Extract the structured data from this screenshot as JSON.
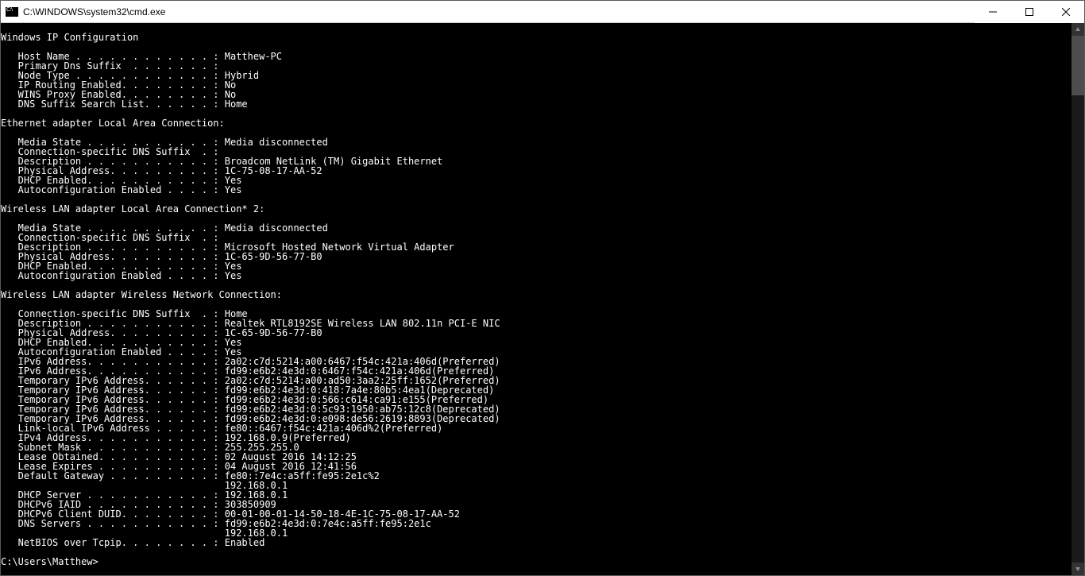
{
  "titlebar": {
    "title": "C:\\WINDOWS\\system32\\cmd.exe"
  },
  "output": {
    "blank0": "",
    "header": "Windows IP Configuration",
    "blank1": "",
    "hostname_line": "   Host Name . . . . . . . . . . . . : Matthew-PC",
    "primdns_line": "   Primary Dns Suffix  . . . . . . . :",
    "nodetype_line": "   Node Type . . . . . . . . . . . . : Hybrid",
    "iprouting_line": "   IP Routing Enabled. . . . . . . . : No",
    "winsproxy_line": "   WINS Proxy Enabled. . . . . . . . : No",
    "dnssuffix_line": "   DNS Suffix Search List. . . . . . : Home",
    "blank2": "",
    "eth_header": "Ethernet adapter Local Area Connection:",
    "blank3": "",
    "eth_media": "   Media State . . . . . . . . . . . : Media disconnected",
    "eth_connspec": "   Connection-specific DNS Suffix  . :",
    "eth_desc": "   Description . . . . . . . . . . . : Broadcom NetLink (TM) Gigabit Ethernet",
    "eth_phys": "   Physical Address. . . . . . . . . : 1C-75-08-17-AA-52",
    "eth_dhcp": "   DHCP Enabled. . . . . . . . . . . : Yes",
    "eth_autoconf": "   Autoconfiguration Enabled . . . . : Yes",
    "blank4": "",
    "wlan2_header": "Wireless LAN adapter Local Area Connection* 2:",
    "blank5": "",
    "wlan2_media": "   Media State . . . . . . . . . . . : Media disconnected",
    "wlan2_connspec": "   Connection-specific DNS Suffix  . :",
    "wlan2_desc": "   Description . . . . . . . . . . . : Microsoft Hosted Network Virtual Adapter",
    "wlan2_phys": "   Physical Address. . . . . . . . . : 1C-65-9D-56-77-B0",
    "wlan2_dhcp": "   DHCP Enabled. . . . . . . . . . . : Yes",
    "wlan2_autoconf": "   Autoconfiguration Enabled . . . . : Yes",
    "blank6": "",
    "wlan_header": "Wireless LAN adapter Wireless Network Connection:",
    "blank7": "",
    "wlan_connspec": "   Connection-specific DNS Suffix  . : Home",
    "wlan_desc": "   Description . . . . . . . . . . . : Realtek RTL8192SE Wireless LAN 802.11n PCI-E NIC",
    "wlan_phys": "   Physical Address. . . . . . . . . : 1C-65-9D-56-77-B0",
    "wlan_dhcp": "   DHCP Enabled. . . . . . . . . . . : Yes",
    "wlan_autoconf": "   Autoconfiguration Enabled . . . . : Yes",
    "wlan_ipv6a": "   IPv6 Address. . . . . . . . . . . : 2a02:c7d:5214:a00:6467:f54c:421a:406d(Preferred)",
    "wlan_ipv6b": "   IPv6 Address. . . . . . . . . . . : fd99:e6b2:4e3d:0:6467:f54c:421a:406d(Preferred)",
    "wlan_tmp1": "   Temporary IPv6 Address. . . . . . : 2a02:c7d:5214:a00:ad50:3aa2:25ff:1652(Preferred)",
    "wlan_tmp2": "   Temporary IPv6 Address. . . . . . : fd99:e6b2:4e3d:0:418:7a4e:80b5:4ea1(Deprecated)",
    "wlan_tmp3": "   Temporary IPv6 Address. . . . . . : fd99:e6b2:4e3d:0:566:c614:ca91:e155(Preferred)",
    "wlan_tmp4": "   Temporary IPv6 Address. . . . . . : fd99:e6b2:4e3d:0:5c93:1950:ab75:12c8(Deprecated)",
    "wlan_tmp5": "   Temporary IPv6 Address. . . . . . : fd99:e6b2:4e3d:0:e098:de56:2619:8893(Deprecated)",
    "wlan_linklocal": "   Link-local IPv6 Address . . . . . : fe80::6467:f54c:421a:406d%2(Preferred)",
    "wlan_ipv4": "   IPv4 Address. . . . . . . . . . . : 192.168.0.9(Preferred)",
    "wlan_subnet": "   Subnet Mask . . . . . . . . . . . : 255.255.255.0",
    "wlan_lease_obt": "   Lease Obtained. . . . . . . . . . : 02 August 2016 14:12:25",
    "wlan_lease_exp": "   Lease Expires . . . . . . . . . . : 04 August 2016 12:41:56",
    "wlan_gw1": "   Default Gateway . . . . . . . . . : fe80::7e4c:a5ff:fe95:2e1c%2",
    "wlan_gw2": "                                       192.168.0.1",
    "wlan_dhcpserv": "   DHCP Server . . . . . . . . . . . : 192.168.0.1",
    "wlan_iaid": "   DHCPv6 IAID . . . . . . . . . . . : 303850909",
    "wlan_duid": "   DHCPv6 Client DUID. . . . . . . . : 00-01-00-01-14-50-18-4E-1C-75-08-17-AA-52",
    "wlan_dns1": "   DNS Servers . . . . . . . . . . . : fd99:e6b2:4e3d:0:7e4c:a5ff:fe95:2e1c",
    "wlan_dns2": "                                       192.168.0.1",
    "wlan_netbios": "   NetBIOS over Tcpip. . . . . . . . : Enabled",
    "blank8": "",
    "prompt": "C:\\Users\\Matthew>"
  }
}
